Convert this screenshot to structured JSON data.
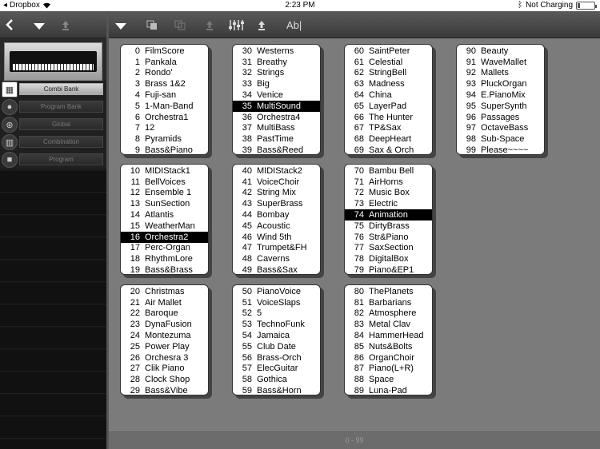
{
  "status_bar": {
    "carrier": "Dropbox",
    "time": "2:23 PM",
    "charging": "Not Charging"
  },
  "toolbar": {
    "text_tool": "Ab|"
  },
  "sidebar": {
    "items": [
      {
        "label": "Combi Bank",
        "active": true
      },
      {
        "label": "Program Bank",
        "active": false
      },
      {
        "label": "Global",
        "active": false
      },
      {
        "label": "Combination",
        "active": false
      },
      {
        "label": "Program",
        "active": false
      }
    ]
  },
  "selected_color": "#000000",
  "range_label": "0 - 99",
  "banks": [
    [
      {
        "num": "0",
        "name": "FilmScore"
      },
      {
        "num": "1",
        "name": "Pankala"
      },
      {
        "num": "2",
        "name": "Rondo'"
      },
      {
        "num": "3",
        "name": "Brass 1&2"
      },
      {
        "num": "4",
        "name": "Fuji-san"
      },
      {
        "num": "5",
        "name": "1-Man-Band"
      },
      {
        "num": "6",
        "name": "Orchestra1"
      },
      {
        "num": "7",
        "name": "12"
      },
      {
        "num": "8",
        "name": "Pyramids"
      },
      {
        "num": "9",
        "name": "Bass&Piano"
      }
    ],
    [
      {
        "num": "30",
        "name": "Westerns"
      },
      {
        "num": "31",
        "name": "Breathy"
      },
      {
        "num": "32",
        "name": "Strings"
      },
      {
        "num": "33",
        "name": "Big"
      },
      {
        "num": "34",
        "name": "Venice"
      },
      {
        "num": "35",
        "name": "MultiSound",
        "selected": true
      },
      {
        "num": "36",
        "name": "Orchestra4"
      },
      {
        "num": "37",
        "name": "MultiBass"
      },
      {
        "num": "38",
        "name": "PastTime"
      },
      {
        "num": "39",
        "name": "Bass&Reed"
      }
    ],
    [
      {
        "num": "60",
        "name": "SaintPeter"
      },
      {
        "num": "61",
        "name": "Celestial"
      },
      {
        "num": "62",
        "name": "StringBell"
      },
      {
        "num": "63",
        "name": "Madness"
      },
      {
        "num": "64",
        "name": "China"
      },
      {
        "num": "65",
        "name": "LayerPad"
      },
      {
        "num": "66",
        "name": "The Hunter"
      },
      {
        "num": "67",
        "name": "TP&Sax"
      },
      {
        "num": "68",
        "name": "DeepHeart"
      },
      {
        "num": "69",
        "name": "Sax & Orch"
      }
    ],
    [
      {
        "num": "90",
        "name": "Beauty"
      },
      {
        "num": "91",
        "name": "WaveMallet"
      },
      {
        "num": "92",
        "name": "Mallets"
      },
      {
        "num": "93",
        "name": "PluckOrgan"
      },
      {
        "num": "94",
        "name": "E.PianoMix"
      },
      {
        "num": "95",
        "name": "SuperSynth"
      },
      {
        "num": "96",
        "name": "Passages"
      },
      {
        "num": "97",
        "name": "OctaveBass"
      },
      {
        "num": "98",
        "name": "Sub-Space"
      },
      {
        "num": "99",
        "name": "Please~~~~"
      }
    ],
    [
      {
        "num": "10",
        "name": "MIDIStack1"
      },
      {
        "num": "11",
        "name": "BellVoices"
      },
      {
        "num": "12",
        "name": "Ensemble 1"
      },
      {
        "num": "13",
        "name": "SunSection"
      },
      {
        "num": "14",
        "name": "Atlantis"
      },
      {
        "num": "15",
        "name": "WeatherMan"
      },
      {
        "num": "16",
        "name": "Orchestra2",
        "selected": true
      },
      {
        "num": "17",
        "name": "Perc-Organ"
      },
      {
        "num": "18",
        "name": "RhythmLore"
      },
      {
        "num": "19",
        "name": "Bass&Brass"
      }
    ],
    [
      {
        "num": "40",
        "name": "MIDIStack2"
      },
      {
        "num": "41",
        "name": "VoiceChoir"
      },
      {
        "num": "42",
        "name": "String Mix"
      },
      {
        "num": "43",
        "name": "SuperBrass"
      },
      {
        "num": "44",
        "name": "Bombay"
      },
      {
        "num": "45",
        "name": "Acoustic"
      },
      {
        "num": "46",
        "name": "Wind 5th"
      },
      {
        "num": "47",
        "name": "Trumpet&FH"
      },
      {
        "num": "48",
        "name": "Caverns"
      },
      {
        "num": "49",
        "name": "Bass&Sax"
      }
    ],
    [
      {
        "num": "70",
        "name": "Bambu Bell"
      },
      {
        "num": "71",
        "name": "AirHorns"
      },
      {
        "num": "72",
        "name": "Music Box"
      },
      {
        "num": "73",
        "name": "Electric"
      },
      {
        "num": "74",
        "name": "Animation",
        "selected": true
      },
      {
        "num": "75",
        "name": "DirtyBrass"
      },
      {
        "num": "76",
        "name": "Str&Piano"
      },
      {
        "num": "77",
        "name": "SaxSection"
      },
      {
        "num": "78",
        "name": "DigitalBox"
      },
      {
        "num": "79",
        "name": "Piano&EP1"
      }
    ],
    [
      {
        "num": "20",
        "name": "Christmas"
      },
      {
        "num": "21",
        "name": "Air Mallet"
      },
      {
        "num": "22",
        "name": "Baroque"
      },
      {
        "num": "23",
        "name": "DynaFusion"
      },
      {
        "num": "24",
        "name": "Montezuma"
      },
      {
        "num": "25",
        "name": "Power Play"
      },
      {
        "num": "26",
        "name": "Orchesra 3"
      },
      {
        "num": "27",
        "name": "Clik Piano"
      },
      {
        "num": "28",
        "name": "Clock Shop"
      },
      {
        "num": "29",
        "name": "Bass&Vibe"
      }
    ],
    [
      {
        "num": "50",
        "name": "PianoVoice"
      },
      {
        "num": "51",
        "name": "VoiceSlaps"
      },
      {
        "num": "52",
        "name": "5"
      },
      {
        "num": "53",
        "name": "TechnoFunk"
      },
      {
        "num": "54",
        "name": "Jamaica"
      },
      {
        "num": "55",
        "name": "Club Date"
      },
      {
        "num": "56",
        "name": "Brass-Orch"
      },
      {
        "num": "57",
        "name": "ElecGuitar"
      },
      {
        "num": "58",
        "name": "Gothica"
      },
      {
        "num": "59",
        "name": "Bass&Horn"
      }
    ],
    [
      {
        "num": "80",
        "name": "ThePlanets"
      },
      {
        "num": "81",
        "name": "Barbarians"
      },
      {
        "num": "82",
        "name": "Atmosphere"
      },
      {
        "num": "83",
        "name": "Metal Clav"
      },
      {
        "num": "84",
        "name": "HammerHead"
      },
      {
        "num": "85",
        "name": "Nuts&Bolts"
      },
      {
        "num": "86",
        "name": "OrganChoir"
      },
      {
        "num": "87",
        "name": "Piano(L+R)"
      },
      {
        "num": "88",
        "name": "Space"
      },
      {
        "num": "89",
        "name": "Luna-Pad"
      }
    ]
  ]
}
